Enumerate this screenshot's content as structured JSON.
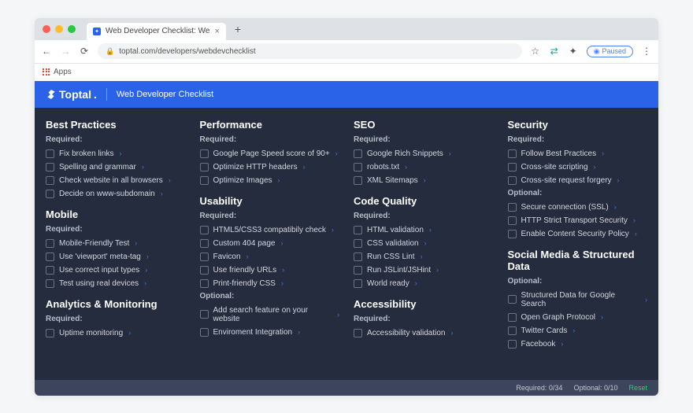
{
  "browser": {
    "tab_title": "Web Developer Checklist: We",
    "url": "toptal.com/developers/webdevchecklist",
    "paused": "Paused",
    "apps": "Apps"
  },
  "header": {
    "logo": "Toptal",
    "subtitle": "Web Developer Checklist"
  },
  "labels": {
    "required": "Required:",
    "optional": "Optional:"
  },
  "columns": [
    {
      "sections": [
        {
          "title": "Best Practices",
          "required": [
            "Fix broken links",
            "Spelling and grammar",
            "Check website in all browsers",
            "Decide on www-subdomain"
          ]
        },
        {
          "title": "Mobile",
          "required": [
            "Mobile-Friendly Test",
            "Use 'viewport' meta-tag",
            "Use correct input types",
            "Test using real devices"
          ]
        },
        {
          "title": "Analytics & Monitoring",
          "required": [
            "Uptime monitoring"
          ]
        }
      ]
    },
    {
      "sections": [
        {
          "title": "Performance",
          "required": [
            "Google Page Speed score of 90+",
            "Optimize HTTP headers",
            "Optimize Images"
          ]
        },
        {
          "title": "Usability",
          "required": [
            "HTML5/CSS3 compatibily check",
            "Custom 404 page",
            "Favicon",
            "Use friendly URLs",
            "Print-friendly CSS"
          ],
          "optional": [
            "Add search feature on your website",
            "Enviroment Integration"
          ]
        }
      ]
    },
    {
      "sections": [
        {
          "title": "SEO",
          "required": [
            "Google Rich Snippets",
            "robots.txt",
            "XML Sitemaps"
          ]
        },
        {
          "title": "Code Quality",
          "required": [
            "HTML validation",
            "CSS validation",
            "Run CSS Lint",
            "Run JSLint/JSHint",
            "World ready"
          ]
        },
        {
          "title": "Accessibility",
          "required": [
            "Accessibility validation"
          ]
        }
      ]
    },
    {
      "sections": [
        {
          "title": "Security",
          "required": [
            "Follow Best Practices",
            "Cross-site scripting",
            "Cross-site request forgery"
          ],
          "optional": [
            "Secure connection (SSL)",
            "HTTP Strict Transport Security",
            "Enable Content Security Policy"
          ]
        },
        {
          "title": "Social Media & Structured Data",
          "optional": [
            "Structured Data for Google Search",
            "Open Graph Protocol",
            "Twitter Cards",
            "Facebook"
          ]
        }
      ]
    }
  ],
  "footer": {
    "required": "Required: 0/34",
    "optional": "Optional: 0/10",
    "reset": "Reset"
  }
}
